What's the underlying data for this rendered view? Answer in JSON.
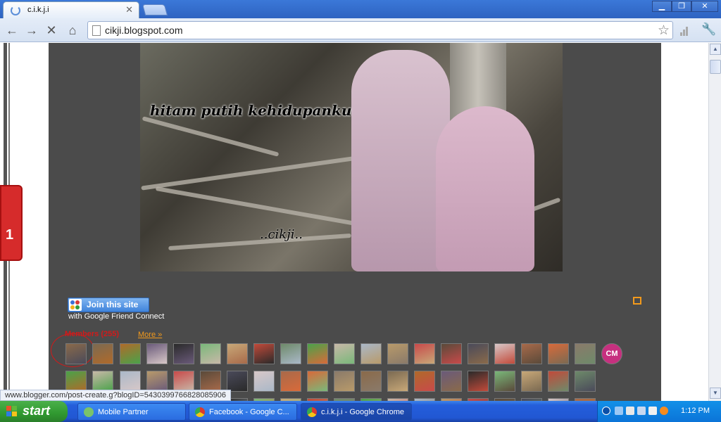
{
  "browser": {
    "tab_title": "c.i.k.j.i",
    "url": "cikji.blogspot.com",
    "status_url": "www.blogger.com/post-create.g?blogID=5430399766828085906"
  },
  "blog": {
    "banner_title": "hitam putih kehidupanku",
    "banner_signature": "..cikji..",
    "join_label": "Join this site",
    "gfc_label": "with Google Friend Connect",
    "members_label": "Members (255)",
    "more_label": "More »",
    "side_tab_label": "1",
    "cm_avatar": "CM"
  },
  "colors": {
    "accent_orange": "#f39a1c",
    "members_red": "#d21a1a",
    "blog_bg": "#4b4b4b"
  },
  "taskbar": {
    "start_label": "start",
    "items": [
      {
        "label": "Mobile Partner"
      },
      {
        "label": "Facebook - Google C..."
      },
      {
        "label": "c.i.k.j.i - Google Chrome"
      }
    ],
    "clock": "1:12 PM"
  }
}
